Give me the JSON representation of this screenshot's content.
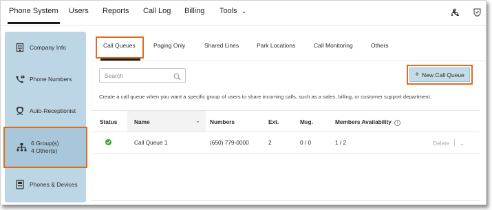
{
  "topnav": {
    "items": [
      {
        "label": "Phone System"
      },
      {
        "label": "Users"
      },
      {
        "label": "Reports"
      },
      {
        "label": "Call Log"
      },
      {
        "label": "Billing"
      },
      {
        "label": "Tools"
      }
    ],
    "active": "Phone System",
    "icons": [
      "sitemap-icon",
      "phone-icon",
      "shield-icon"
    ]
  },
  "sidebar": {
    "items": [
      {
        "label": "Company Info",
        "icon": "building-icon"
      },
      {
        "label": "Phone Numbers",
        "icon": "phone-hash-icon"
      },
      {
        "label": "Auto-Receptionist",
        "icon": "receptionist-icon"
      },
      {
        "label_line1": "6 Group(s)",
        "label_line2": "4 Other(s)",
        "icon": "org-chart-icon",
        "selected": true
      },
      {
        "label": "Phones & Devices",
        "icon": "desk-phone-icon"
      }
    ]
  },
  "subtabs": {
    "items": [
      {
        "label": "Call Queues"
      },
      {
        "label": "Paging Only"
      },
      {
        "label": "Shared Lines"
      },
      {
        "label": "Park Locations"
      },
      {
        "label": "Call Monitoring"
      },
      {
        "label": "Others"
      }
    ],
    "active": "Call Queues"
  },
  "search": {
    "placeholder": "Search",
    "value": ""
  },
  "new_button": {
    "label": "New Call Queue",
    "icon": "plus-icon"
  },
  "description": "Create a call queue when you want a specific group of users to share incoming calls, such as a sales, billing, or customer support department.",
  "table": {
    "headers": {
      "status": "Status",
      "name": "Name",
      "numbers": "Numbers",
      "ext": "Ext.",
      "msg": "Msg.",
      "members": "Members Availability"
    },
    "rows": [
      {
        "status": "active",
        "name": "Call Queue 1",
        "numbers": "(650) 779-0000",
        "ext": "2",
        "msg": "0 / 0",
        "members": "1 / 2",
        "delete_label": "Delete"
      }
    ]
  },
  "colors": {
    "highlight": "#e06a1b",
    "sidebar_bg": "#bcd6e6",
    "button_bg": "#c4dbe8",
    "status_green": "#3aa63a"
  }
}
